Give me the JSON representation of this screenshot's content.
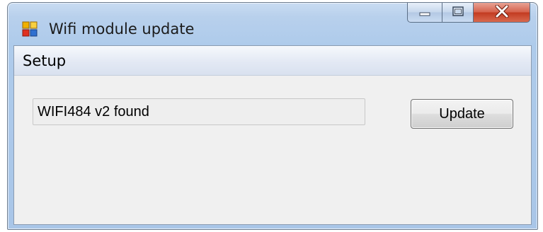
{
  "window": {
    "title": "Wifi module update",
    "app_icon": "application-window-icon",
    "caption_buttons": {
      "minimize_icon": "minimize-icon",
      "maximize_icon": "maximize-icon",
      "close_icon": "close-icon"
    }
  },
  "menu": {
    "items": [
      {
        "label": "Setup"
      }
    ]
  },
  "main": {
    "status_value": "WIFI484 v2 found",
    "update_label": "Update"
  },
  "colors": {
    "titlebar": "#b8d0ec",
    "close_button": "#c23a20",
    "client_background": "#f0f0f0"
  }
}
